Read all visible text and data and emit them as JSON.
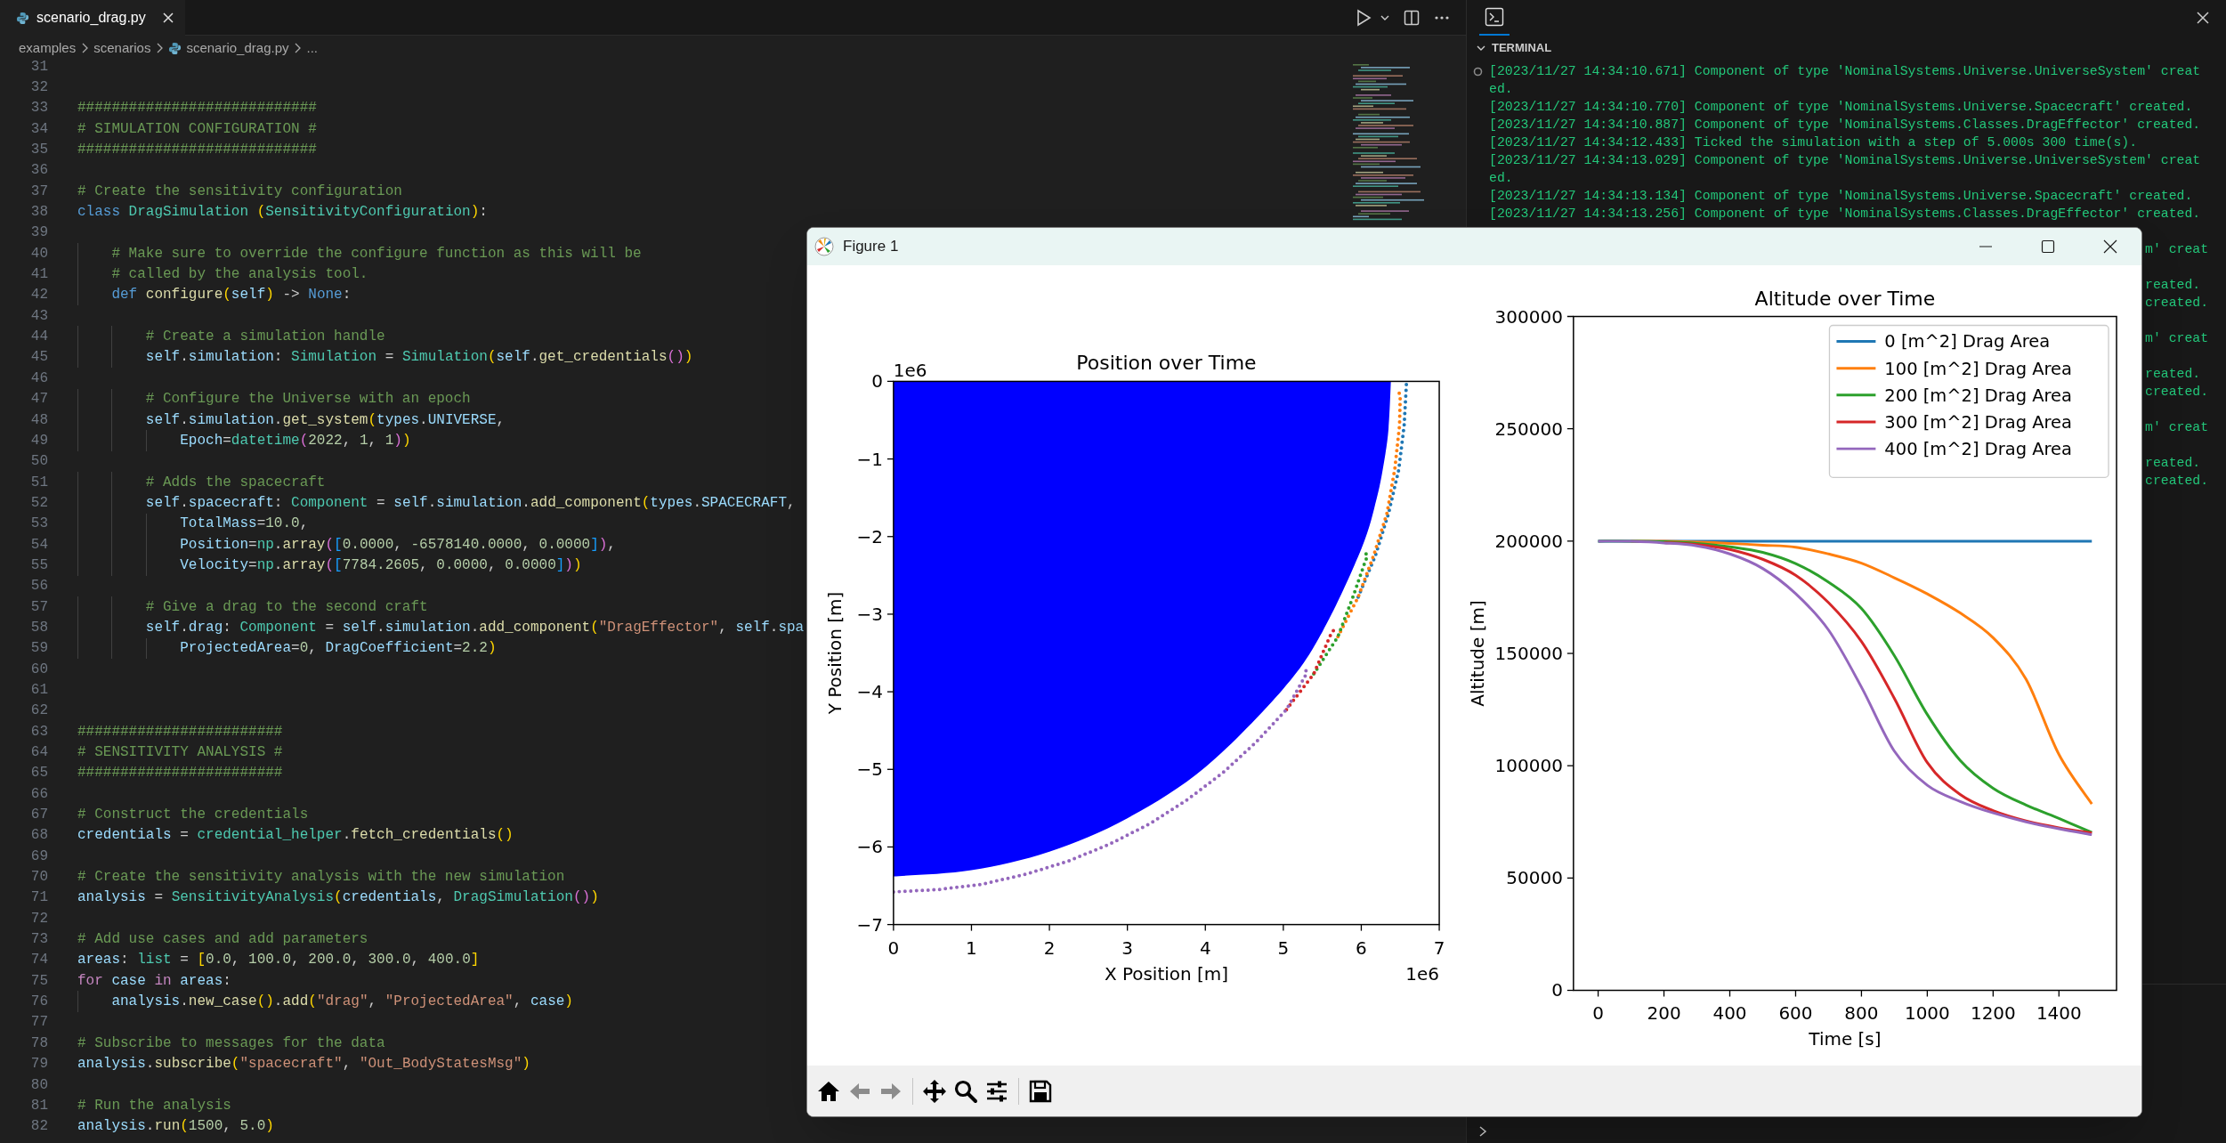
{
  "editor": {
    "tabs": [
      {
        "label": "scenario_drag.py",
        "selected": true
      }
    ],
    "breadcrumb": [
      {
        "text": "examples"
      },
      {
        "text": "scenarios"
      },
      {
        "text": "scenario_drag.py",
        "kind": "file"
      },
      {
        "text": "..."
      }
    ],
    "lines": [
      {
        "number": "31"
      },
      {
        "number": "32"
      },
      {
        "number": "33",
        "tokens": [
          {
            "kind": "comment",
            "text": "############################"
          }
        ]
      },
      {
        "number": "34",
        "tokens": [
          {
            "kind": "comment",
            "text": "# SIMULATION CONFIGURATION #"
          }
        ]
      },
      {
        "number": "35",
        "tokens": [
          {
            "kind": "comment",
            "text": "############################"
          }
        ]
      },
      {
        "number": "36"
      },
      {
        "number": "37",
        "tokens": [
          {
            "kind": "comment",
            "text": "# Create the sensitivity configuration"
          }
        ]
      },
      {
        "number": "38",
        "tokens": [
          {
            "kind": "keyword",
            "text": "class "
          },
          {
            "kind": "type",
            "text": "DragSimulation "
          },
          {
            "kind": "bracket1",
            "text": "("
          },
          {
            "kind": "type",
            "text": "SensitivityConfiguration"
          },
          {
            "kind": "bracket1",
            "text": ")"
          },
          {
            "kind": "plain",
            "text": ":"
          }
        ]
      },
      {
        "number": "39"
      },
      {
        "number": "40",
        "tokens": [
          {
            "kind": "comment",
            "text": "    # Make sure to override the configure function as this will be"
          }
        ]
      },
      {
        "number": "41",
        "tokens": [
          {
            "kind": "comment",
            "text": "    # called by the analysis tool."
          }
        ]
      },
      {
        "number": "42",
        "tokens": [
          {
            "kind": "keyword",
            "text": "    def "
          },
          {
            "kind": "function",
            "text": "configure"
          },
          {
            "kind": "bracket1",
            "text": "("
          },
          {
            "kind": "variable",
            "text": "self"
          },
          {
            "kind": "bracket1",
            "text": ")"
          },
          {
            "kind": "plain",
            "text": " -> "
          },
          {
            "kind": "keyword",
            "text": "None"
          },
          {
            "kind": "plain",
            "text": ":"
          }
        ]
      },
      {
        "number": "43"
      },
      {
        "number": "44",
        "tokens": [
          {
            "kind": "comment",
            "text": "        # Create a simulation handle"
          }
        ]
      },
      {
        "number": "45",
        "tokens": [
          {
            "kind": "variable",
            "text": "        self"
          },
          {
            "kind": "plain",
            "text": "."
          },
          {
            "kind": "variable",
            "text": "simulation"
          },
          {
            "kind": "plain",
            "text": ": "
          },
          {
            "kind": "type",
            "text": "Simulation"
          },
          {
            "kind": "plain",
            "text": " = "
          },
          {
            "kind": "type",
            "text": "Simulation"
          },
          {
            "kind": "bracket1",
            "text": "("
          },
          {
            "kind": "variable",
            "text": "self"
          },
          {
            "kind": "plain",
            "text": "."
          },
          {
            "kind": "function",
            "text": "get_credentials"
          },
          {
            "kind": "bracket2",
            "text": "()"
          },
          {
            "kind": "bracket1",
            "text": ")"
          }
        ]
      },
      {
        "number": "46"
      },
      {
        "number": "47",
        "tokens": [
          {
            "kind": "comment",
            "text": "        # Configure the Universe with an epoch"
          }
        ]
      },
      {
        "number": "48",
        "tokens": [
          {
            "kind": "variable",
            "text": "        self"
          },
          {
            "kind": "plain",
            "text": "."
          },
          {
            "kind": "variable",
            "text": "simulation"
          },
          {
            "kind": "plain",
            "text": "."
          },
          {
            "kind": "function",
            "text": "get_system"
          },
          {
            "kind": "bracket1",
            "text": "("
          },
          {
            "kind": "variable",
            "text": "types"
          },
          {
            "kind": "plain",
            "text": "."
          },
          {
            "kind": "variable",
            "text": "UNIVERSE"
          },
          {
            "kind": "plain",
            "text": ","
          }
        ]
      },
      {
        "number": "49",
        "tokens": [
          {
            "kind": "variable",
            "text": "            Epoch"
          },
          {
            "kind": "plain",
            "text": "="
          },
          {
            "kind": "type",
            "text": "datetime"
          },
          {
            "kind": "bracket2",
            "text": "("
          },
          {
            "kind": "number",
            "text": "2022"
          },
          {
            "kind": "plain",
            "text": ", "
          },
          {
            "kind": "number",
            "text": "1"
          },
          {
            "kind": "plain",
            "text": ", "
          },
          {
            "kind": "number",
            "text": "1"
          },
          {
            "kind": "bracket2",
            "text": ")"
          },
          {
            "kind": "bracket1",
            "text": ")"
          }
        ]
      },
      {
        "number": "50"
      },
      {
        "number": "51",
        "tokens": [
          {
            "kind": "comment",
            "text": "        # Adds the spacecraft"
          }
        ]
      },
      {
        "number": "52",
        "tokens": [
          {
            "kind": "variable",
            "text": "        self"
          },
          {
            "kind": "plain",
            "text": "."
          },
          {
            "kind": "variable",
            "text": "spacecraft"
          },
          {
            "kind": "plain",
            "text": ": "
          },
          {
            "kind": "type",
            "text": "Component"
          },
          {
            "kind": "plain",
            "text": " = "
          },
          {
            "kind": "variable",
            "text": "self"
          },
          {
            "kind": "plain",
            "text": "."
          },
          {
            "kind": "variable",
            "text": "simulation"
          },
          {
            "kind": "plain",
            "text": "."
          },
          {
            "kind": "function",
            "text": "add_component"
          },
          {
            "kind": "bracket1",
            "text": "("
          },
          {
            "kind": "variable",
            "text": "types"
          },
          {
            "kind": "plain",
            "text": "."
          },
          {
            "kind": "variable",
            "text": "SPACECRAFT"
          },
          {
            "kind": "plain",
            "text": ","
          }
        ]
      },
      {
        "number": "53",
        "tokens": [
          {
            "kind": "variable",
            "text": "            TotalMass"
          },
          {
            "kind": "plain",
            "text": "="
          },
          {
            "kind": "number",
            "text": "10.0"
          },
          {
            "kind": "plain",
            "text": ","
          }
        ]
      },
      {
        "number": "54",
        "tokens": [
          {
            "kind": "variable",
            "text": "            Position"
          },
          {
            "kind": "plain",
            "text": "="
          },
          {
            "kind": "type",
            "text": "np"
          },
          {
            "kind": "plain",
            "text": "."
          },
          {
            "kind": "function",
            "text": "array"
          },
          {
            "kind": "bracket2",
            "text": "("
          },
          {
            "kind": "bracket3",
            "text": "["
          },
          {
            "kind": "number",
            "text": "0.0000"
          },
          {
            "kind": "plain",
            "text": ", "
          },
          {
            "kind": "number",
            "text": "-6578140.0000"
          },
          {
            "kind": "plain",
            "text": ", "
          },
          {
            "kind": "number",
            "text": "0.0000"
          },
          {
            "kind": "bracket3",
            "text": "]"
          },
          {
            "kind": "bracket2",
            "text": ")"
          },
          {
            "kind": "plain",
            "text": ","
          }
        ]
      },
      {
        "number": "55",
        "tokens": [
          {
            "kind": "variable",
            "text": "            Velocity"
          },
          {
            "kind": "plain",
            "text": "="
          },
          {
            "kind": "type",
            "text": "np"
          },
          {
            "kind": "plain",
            "text": "."
          },
          {
            "kind": "function",
            "text": "array"
          },
          {
            "kind": "bracket2",
            "text": "("
          },
          {
            "kind": "bracket3",
            "text": "["
          },
          {
            "kind": "number",
            "text": "7784.2605"
          },
          {
            "kind": "plain",
            "text": ", "
          },
          {
            "kind": "number",
            "text": "0.0000"
          },
          {
            "kind": "plain",
            "text": ", "
          },
          {
            "kind": "number",
            "text": "0.0000"
          },
          {
            "kind": "bracket3",
            "text": "]"
          },
          {
            "kind": "bracket2",
            "text": ")"
          },
          {
            "kind": "bracket1",
            "text": ")"
          }
        ]
      },
      {
        "number": "56"
      },
      {
        "number": "57",
        "tokens": [
          {
            "kind": "comment",
            "text": "        # Give a drag to the second craft"
          }
        ]
      },
      {
        "number": "58",
        "tokens": [
          {
            "kind": "variable",
            "text": "        self"
          },
          {
            "kind": "plain",
            "text": "."
          },
          {
            "kind": "variable",
            "text": "drag"
          },
          {
            "kind": "plain",
            "text": ": "
          },
          {
            "kind": "type",
            "text": "Component"
          },
          {
            "kind": "plain",
            "text": " = "
          },
          {
            "kind": "variable",
            "text": "self"
          },
          {
            "kind": "plain",
            "text": "."
          },
          {
            "kind": "variable",
            "text": "simulation"
          },
          {
            "kind": "plain",
            "text": "."
          },
          {
            "kind": "function",
            "text": "add_component"
          },
          {
            "kind": "bracket1",
            "text": "("
          },
          {
            "kind": "string",
            "text": "\"DragEffector\""
          },
          {
            "kind": "plain",
            "text": ", "
          },
          {
            "kind": "variable",
            "text": "self"
          },
          {
            "kind": "plain",
            "text": "."
          },
          {
            "kind": "variable",
            "text": "spa"
          }
        ]
      },
      {
        "number": "59",
        "tokens": [
          {
            "kind": "variable",
            "text": "            ProjectedArea"
          },
          {
            "kind": "plain",
            "text": "="
          },
          {
            "kind": "number",
            "text": "0"
          },
          {
            "kind": "plain",
            "text": ", "
          },
          {
            "kind": "variable",
            "text": "DragCoefficient"
          },
          {
            "kind": "plain",
            "text": "="
          },
          {
            "kind": "number",
            "text": "2.2"
          },
          {
            "kind": "bracket1",
            "text": ")"
          }
        ]
      },
      {
        "number": "60"
      },
      {
        "number": "61"
      },
      {
        "number": "62"
      },
      {
        "number": "63",
        "tokens": [
          {
            "kind": "comment",
            "text": "########################"
          }
        ]
      },
      {
        "number": "64",
        "tokens": [
          {
            "kind": "comment",
            "text": "# SENSITIVITY ANALYSIS #"
          }
        ]
      },
      {
        "number": "65",
        "tokens": [
          {
            "kind": "comment",
            "text": "########################"
          }
        ]
      },
      {
        "number": "66"
      },
      {
        "number": "67",
        "tokens": [
          {
            "kind": "comment",
            "text": "# Construct the credentials"
          }
        ]
      },
      {
        "number": "68",
        "tokens": [
          {
            "kind": "variable",
            "text": "credentials"
          },
          {
            "kind": "plain",
            "text": " = "
          },
          {
            "kind": "type",
            "text": "credential_helper"
          },
          {
            "kind": "plain",
            "text": "."
          },
          {
            "kind": "function",
            "text": "fetch_credentials"
          },
          {
            "kind": "bracket1",
            "text": "()"
          }
        ]
      },
      {
        "number": "69"
      },
      {
        "number": "70",
        "tokens": [
          {
            "kind": "comment",
            "text": "# Create the sensitivity analysis with the new simulation"
          }
        ]
      },
      {
        "number": "71",
        "tokens": [
          {
            "kind": "variable",
            "text": "analysis"
          },
          {
            "kind": "plain",
            "text": " = "
          },
          {
            "kind": "type",
            "text": "SensitivityAnalysis"
          },
          {
            "kind": "bracket1",
            "text": "("
          },
          {
            "kind": "variable",
            "text": "credentials"
          },
          {
            "kind": "plain",
            "text": ", "
          },
          {
            "kind": "type",
            "text": "DragSimulation"
          },
          {
            "kind": "bracket2",
            "text": "()"
          },
          {
            "kind": "bracket1",
            "text": ")"
          }
        ]
      },
      {
        "number": "72"
      },
      {
        "number": "73",
        "tokens": [
          {
            "kind": "comment",
            "text": "# Add use cases and add parameters"
          }
        ]
      },
      {
        "number": "74",
        "tokens": [
          {
            "kind": "variable",
            "text": "areas"
          },
          {
            "kind": "plain",
            "text": ": "
          },
          {
            "kind": "type",
            "text": "list"
          },
          {
            "kind": "plain",
            "text": " = "
          },
          {
            "kind": "bracket1",
            "text": "["
          },
          {
            "kind": "number",
            "text": "0.0"
          },
          {
            "kind": "plain",
            "text": ", "
          },
          {
            "kind": "number",
            "text": "100.0"
          },
          {
            "kind": "plain",
            "text": ", "
          },
          {
            "kind": "number",
            "text": "200.0"
          },
          {
            "kind": "plain",
            "text": ", "
          },
          {
            "kind": "number",
            "text": "300.0"
          },
          {
            "kind": "plain",
            "text": ", "
          },
          {
            "kind": "number",
            "text": "400.0"
          },
          {
            "kind": "bracket1",
            "text": "]"
          }
        ]
      },
      {
        "number": "75",
        "tokens": [
          {
            "kind": "control",
            "text": "for "
          },
          {
            "kind": "variable",
            "text": "case "
          },
          {
            "kind": "control",
            "text": "in "
          },
          {
            "kind": "variable",
            "text": "areas"
          },
          {
            "kind": "plain",
            "text": ":"
          }
        ]
      },
      {
        "number": "76",
        "tokens": [
          {
            "kind": "variable",
            "text": "    analysis"
          },
          {
            "kind": "plain",
            "text": "."
          },
          {
            "kind": "function",
            "text": "new_case"
          },
          {
            "kind": "bracket1",
            "text": "()"
          },
          {
            "kind": "plain",
            "text": "."
          },
          {
            "kind": "function",
            "text": "add"
          },
          {
            "kind": "bracket1",
            "text": "("
          },
          {
            "kind": "string",
            "text": "\"drag\""
          },
          {
            "kind": "plain",
            "text": ", "
          },
          {
            "kind": "string",
            "text": "\"ProjectedArea\""
          },
          {
            "kind": "plain",
            "text": ", "
          },
          {
            "kind": "variable",
            "text": "case"
          },
          {
            "kind": "bracket1",
            "text": ")"
          }
        ]
      },
      {
        "number": "77"
      },
      {
        "number": "78",
        "tokens": [
          {
            "kind": "comment",
            "text": "# Subscribe to messages for the data"
          }
        ]
      },
      {
        "number": "79",
        "tokens": [
          {
            "kind": "variable",
            "text": "analysis"
          },
          {
            "kind": "plain",
            "text": "."
          },
          {
            "kind": "function",
            "text": "subscribe"
          },
          {
            "kind": "bracket1",
            "text": "("
          },
          {
            "kind": "string",
            "text": "\"spacecraft\""
          },
          {
            "kind": "plain",
            "text": ", "
          },
          {
            "kind": "string",
            "text": "\"Out_BodyStatesMsg\""
          },
          {
            "kind": "bracket1",
            "text": ")"
          }
        ]
      },
      {
        "number": "80"
      },
      {
        "number": "81",
        "tokens": [
          {
            "kind": "comment",
            "text": "# Run the analysis"
          }
        ]
      },
      {
        "number": "82",
        "tokens": [
          {
            "kind": "variable",
            "text": "analysis"
          },
          {
            "kind": "plain",
            "text": "."
          },
          {
            "kind": "function",
            "text": "run"
          },
          {
            "kind": "bracket1",
            "text": "("
          },
          {
            "kind": "number",
            "text": "1500"
          },
          {
            "kind": "plain",
            "text": ", "
          },
          {
            "kind": "number",
            "text": "5.0"
          },
          {
            "kind": "bracket1",
            "text": ")"
          }
        ]
      }
    ]
  },
  "panel": {
    "tabs": [
      {
        "kind": "terminal",
        "selected": true
      }
    ],
    "section": {
      "title": "TERMINAL",
      "expanded": true
    },
    "terminal": {
      "marker": true,
      "rows": [
        {
          "kind": "log",
          "text": "[2023/11/27 14:34:10.671] Component of type 'NominalSystems.Universe.UniverseSystem' creat"
        },
        {
          "kind": "log",
          "text": "ed."
        },
        {
          "kind": "log",
          "text": "[2023/11/27 14:34:10.770] Component of type 'NominalSystems.Universe.Spacecraft' created."
        },
        {
          "kind": "log",
          "text": "[2023/11/27 14:34:10.887] Component of type 'NominalSystems.Classes.DragEffector' created."
        },
        {
          "kind": "log",
          "text": "[2023/11/27 14:34:12.433] Ticked the simulation with a step of 5.000s 300 time(s)."
        },
        {
          "kind": "log",
          "text": "[2023/11/27 14:34:13.029] Component of type 'NominalSystems.Universe.UniverseSystem' creat"
        },
        {
          "kind": "log",
          "text": "ed."
        },
        {
          "kind": "log",
          "text": "[2023/11/27 14:34:13.134] Component of type 'NominalSystems.Universe.Spacecraft' created."
        },
        {
          "kind": "log",
          "text": "[2023/11/27 14:34:13.256] Component of type 'NominalSystems.Classes.DragEffector' created."
        },
        {
          "kind": "covered"
        },
        {
          "kind": "fragment",
          "text": "m' creat"
        },
        {
          "kind": "covered"
        },
        {
          "kind": "fragment",
          "text": "reated."
        },
        {
          "kind": "fragment",
          "text": "created."
        },
        {
          "kind": "covered"
        },
        {
          "kind": "fragment",
          "text": "m' creat"
        },
        {
          "kind": "covered"
        },
        {
          "kind": "fragment",
          "text": "reated."
        },
        {
          "kind": "fragment",
          "text": "created."
        },
        {
          "kind": "covered"
        },
        {
          "kind": "fragment",
          "text": "m' creat"
        },
        {
          "kind": "covered"
        },
        {
          "kind": "fragment",
          "text": "reated."
        },
        {
          "kind": "fragment",
          "text": "created."
        }
      ]
    }
  },
  "figure_window": {
    "title": "Figure 1",
    "charts": [
      {
        "x_offset_label": "1e6",
        "y_offset_label": "1e6",
        "chart_data": {
          "type": "line",
          "title": "Position over Time",
          "xlabel": "X Position [m]",
          "ylabel": "Y Position [m]",
          "xlim": [
            0,
            7
          ],
          "ylim": [
            -7,
            0
          ],
          "xticks": [
            {
              "value": 0,
              "label": "0"
            },
            {
              "value": 1,
              "label": "1"
            },
            {
              "value": 2,
              "label": "2"
            },
            {
              "value": 3,
              "label": "3"
            },
            {
              "value": 4,
              "label": "4"
            },
            {
              "value": 5,
              "label": "5"
            },
            {
              "value": 6,
              "label": "6"
            },
            {
              "value": 7,
              "label": "7"
            }
          ],
          "yticks": [
            {
              "value": 0,
              "label": "0"
            },
            {
              "value": -1,
              "label": "−1"
            },
            {
              "value": -2,
              "label": "−2"
            },
            {
              "value": -3,
              "label": "−3"
            },
            {
              "value": -4,
              "label": "−4"
            },
            {
              "value": -5,
              "label": "−5"
            },
            {
              "value": -6,
              "label": "−6"
            },
            {
              "value": -7,
              "label": "−7"
            }
          ],
          "series": [
            {
              "type": "area",
              "color": "#0000ff",
              "x": [
                0,
                1,
                2,
                3,
                4,
                5,
                5.5,
                6,
                6.2,
                6.3,
                6.35,
                6.38
              ],
              "values": [
                -6.38,
                -6.3,
                -6.06,
                -5.63,
                -4.97,
                -3.96,
                -3.23,
                -2.16,
                -1.5,
                -0.99,
                -0.6,
                0
              ]
            },
            {
              "color": "#1f77b4",
              "line_style": "dotted",
              "x": [
                5.96,
                6.18,
                6.35,
                6.48,
                6.55,
                6.58
              ],
              "values": [
                -2.78,
                -2.25,
                -1.7,
                -1.14,
                -0.57,
                0
              ]
            },
            {
              "color": "#ff7f0e",
              "line_style": "dotted",
              "x": [
                5.7,
                5.96,
                6.16,
                6.33,
                6.43,
                6.49,
                6.5,
                6.47
              ],
              "values": [
                -3.29,
                -2.78,
                -2.24,
                -1.7,
                -1.13,
                -0.57,
                -0.2,
                -0.09
              ]
            },
            {
              "color": "#2ca02c",
              "line_style": "dotted",
              "x": [
                5.39,
                5.7,
                5.9,
                6.05,
                6.08,
                6.06
              ],
              "values": [
                -3.77,
                -3.29,
                -2.76,
                -2.32,
                -2.25,
                -2.22
              ]
            },
            {
              "color": "#d62728",
              "line_style": "dotted",
              "x": [
                5.04,
                5.39,
                5.6,
                5.65,
                5.63
              ],
              "values": [
                -4.23,
                -3.77,
                -3.28,
                -3.2,
                -3.17
              ]
            },
            {
              "color": "#9467bd",
              "line_style": "dotted",
              "x": [
                0,
                0.57,
                1.14,
                1.7,
                2.25,
                2.78,
                3.29,
                3.77,
                4.23,
                4.65,
                5.04,
                5.29,
                5.3,
                5.28
              ],
              "values": [
                -6.58,
                -6.55,
                -6.48,
                -6.35,
                -6.18,
                -5.96,
                -5.7,
                -5.39,
                -5.04,
                -4.65,
                -4.23,
                -3.78,
                -3.74,
                -3.72
              ]
            }
          ]
        }
      },
      {
        "chart_data": {
          "type": "line",
          "title": "Altitude over Time",
          "xlabel": "Time [s]",
          "ylabel": "Altitude [m]",
          "xlim": [
            -75,
            1575
          ],
          "ylim": [
            0,
            300000
          ],
          "xticks": [
            {
              "value": 0,
              "label": "0"
            },
            {
              "value": 200,
              "label": "200"
            },
            {
              "value": 400,
              "label": "400"
            },
            {
              "value": 600,
              "label": "600"
            },
            {
              "value": 800,
              "label": "800"
            },
            {
              "value": 1000,
              "label": "1000"
            },
            {
              "value": 1200,
              "label": "1200"
            },
            {
              "value": 1400,
              "label": "1400"
            }
          ],
          "yticks": [
            {
              "value": 0,
              "label": "0"
            },
            {
              "value": 50000,
              "label": "50000"
            },
            {
              "value": 100000,
              "label": "100000"
            },
            {
              "value": 150000,
              "label": "150000"
            },
            {
              "value": 200000,
              "label": "200000"
            },
            {
              "value": 250000,
              "label": "250000"
            },
            {
              "value": 300000,
              "label": "300000"
            }
          ],
          "legend": true,
          "x": [
            0,
            100,
            200,
            300,
            400,
            500,
            600,
            700,
            800,
            900,
            1000,
            1100,
            1200,
            1300,
            1400,
            1500
          ],
          "series": [
            {
              "name": "0 [m^2] Drag Area",
              "color": "#1f77b4",
              "values": [
                200000,
                200000,
                200000,
                200000,
                200000,
                200000,
                200000,
                200000,
                200000,
                200000,
                200000,
                200000,
                200000,
                200000,
                200000,
                200000
              ]
            },
            {
              "name": "100 [m^2] Drag Area",
              "color": "#ff7f0e",
              "values": [
                null,
                200000,
                199900,
                199600,
                199000,
                198200,
                197300,
                194300,
                190200,
                183700,
                176500,
                168000,
                157000,
                138500,
                105000,
                83000
              ]
            },
            {
              "name": "200 [m^2] Drag Area",
              "color": "#2ca02c",
              "values": [
                200000,
                200000,
                199700,
                199000,
                197500,
                195000,
                190000,
                181700,
                170000,
                149000,
                122800,
                102400,
                90000,
                82500,
                76500,
                70300
              ]
            },
            {
              "name": "300 [m^2] Drag Area",
              "color": "#d62728",
              "values": [
                null,
                null,
                199400,
                198500,
                196300,
                191900,
                184800,
                172600,
                155300,
                130000,
                101400,
                87200,
                80000,
                75400,
                72400,
                70000
              ]
            },
            {
              "name": "400 [m^2] Drag Area",
              "color": "#9467bd",
              "values": [
                200000,
                199900,
                199200,
                197900,
                194300,
                187800,
                176600,
                160400,
                135000,
                106500,
                91300,
                84100,
                79000,
                75000,
                71900,
                69300
              ]
            }
          ]
        }
      }
    ],
    "toolbar": [
      {
        "kind": "home",
        "disabled": false
      },
      {
        "kind": "back",
        "disabled": true
      },
      {
        "kind": "forward",
        "disabled": true
      },
      {
        "kind": "separator"
      },
      {
        "kind": "pan",
        "disabled": false
      },
      {
        "kind": "zoom",
        "disabled": false
      },
      {
        "kind": "configure",
        "disabled": false
      },
      {
        "kind": "separator"
      },
      {
        "kind": "save",
        "disabled": false
      }
    ]
  }
}
